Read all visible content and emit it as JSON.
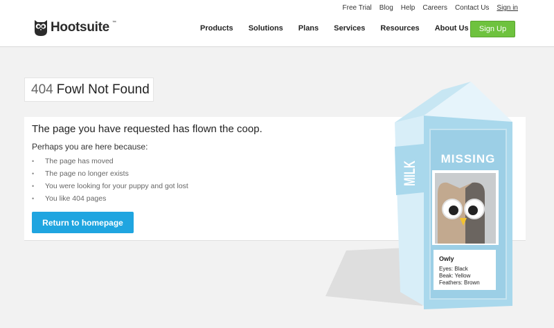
{
  "header": {
    "logo_text": "Hootsuite",
    "logo_tm": "™",
    "util_nav": [
      "Free Trial",
      "Blog",
      "Help",
      "Careers",
      "Contact Us",
      "Sign in"
    ],
    "main_nav": [
      "Products",
      "Solutions",
      "Plans",
      "Services",
      "Resources",
      "About Us"
    ],
    "signup_label": "Sign Up"
  },
  "error": {
    "code": "404",
    "title": "Fowl Not Found",
    "headline": "The page you have requested has flown the coop.",
    "intro": "Perhaps you are here because:",
    "reasons": [
      "The page has moved",
      "The page no longer exists",
      "You were looking for your puppy and got lost",
      "You like 404 pages"
    ],
    "button_label": "Return to homepage"
  },
  "carton": {
    "side_text": "MILK",
    "banner": "MISSING",
    "name": "Owly",
    "eyes": "Eyes: Black",
    "beak": "Beak: Yellow",
    "feathers": "Feathers: Brown"
  },
  "colors": {
    "signup_green": "#6ec23e",
    "button_blue": "#1fa5e0",
    "carton_blue": "#a9d8ec",
    "background": "#f2f2f2"
  }
}
